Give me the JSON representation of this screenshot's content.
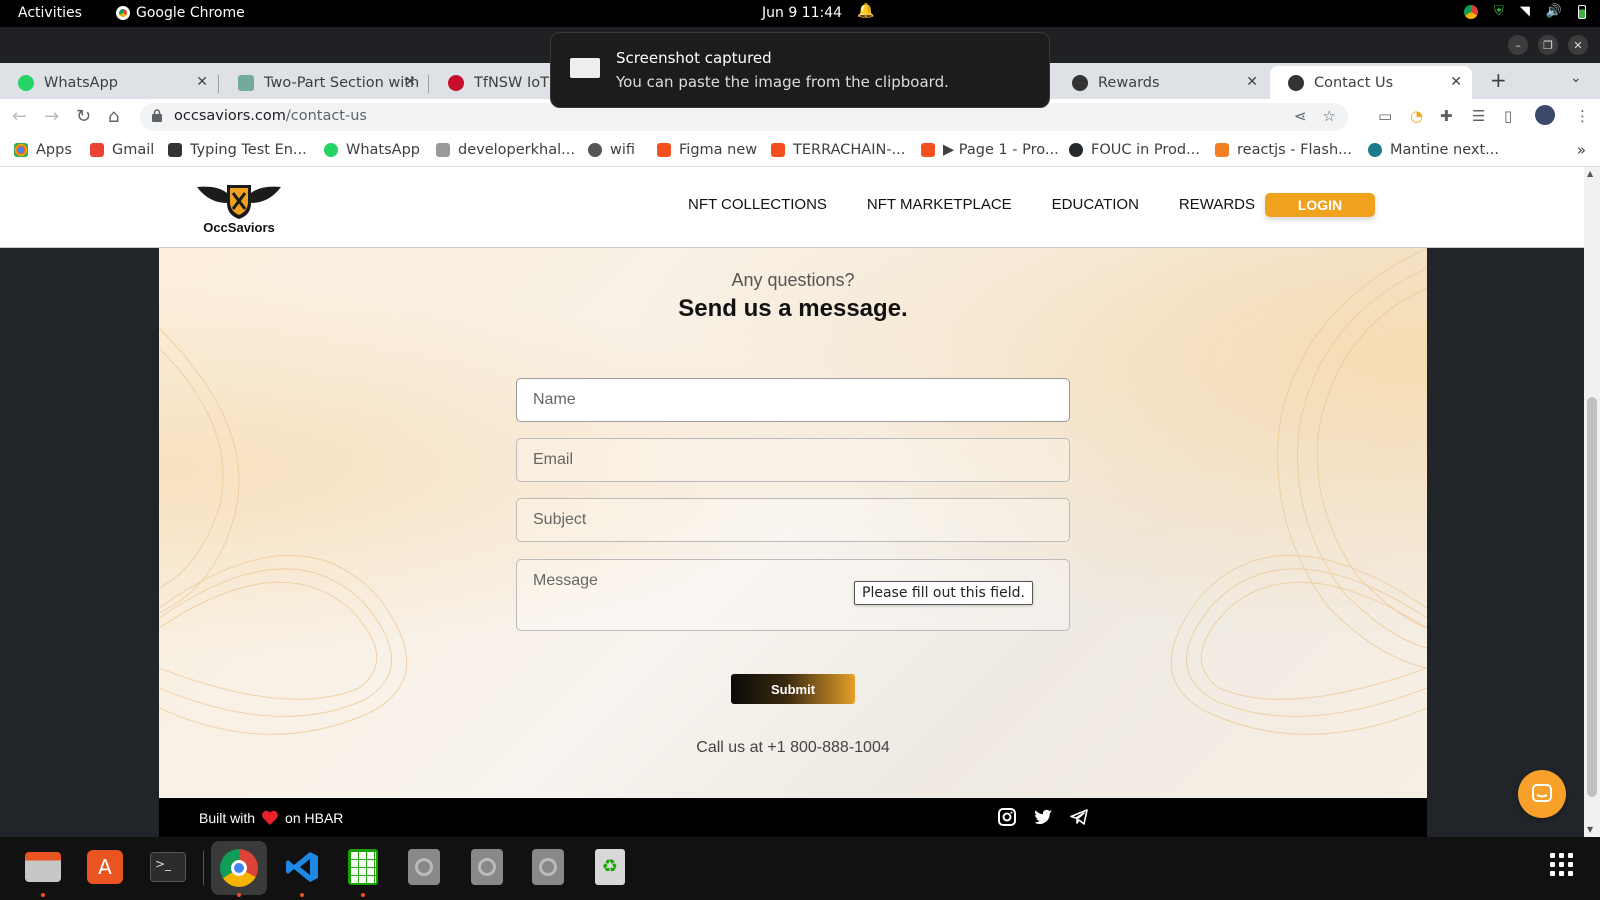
{
  "system_bar": {
    "activities": "Activities",
    "app_name": "Google Chrome",
    "clock": "Jun 9  11:44"
  },
  "tabs": [
    {
      "title": "WhatsApp",
      "active": false
    },
    {
      "title": "Two-Part Section with",
      "active": false
    },
    {
      "title": "TfNSW IoT C",
      "active": false
    },
    {
      "title": "Rewards",
      "active": false
    },
    {
      "title": "Contact Us",
      "active": true
    }
  ],
  "address_bar": {
    "domain": "occsaviors.com",
    "path": "/contact-us"
  },
  "bookmarks": [
    {
      "label": "Apps",
      "color": "#4285f4"
    },
    {
      "label": "Gmail",
      "color": "#ea4335"
    },
    {
      "label": "Typing Test En...",
      "color": "#333333"
    },
    {
      "label": "WhatsApp",
      "color": "#25d366"
    },
    {
      "label": "developerkhal...",
      "color": "#999999"
    },
    {
      "label": "wifi",
      "color": "#555555"
    },
    {
      "label": "Figma new",
      "color": "#f24e1e"
    },
    {
      "label": "TERRACHAIN-...",
      "color": "#f24e1e"
    },
    {
      "label": "▶ Page 1 - Pro...",
      "color": "#f24e1e"
    },
    {
      "label": "FOUC in Prod...",
      "color": "#24292e"
    },
    {
      "label": "reactjs - Flash...",
      "color": "#f48024"
    },
    {
      "label": "Mantine next...",
      "color": "#1c7c8c"
    }
  ],
  "notification": {
    "title": "Screenshot captured",
    "body": "You can paste the image from the clipboard."
  },
  "site": {
    "brand": "OccSaviors",
    "nav": [
      "NFT COLLECTIONS",
      "NFT MARKETPLACE",
      "EDUCATION",
      "REWARDS"
    ],
    "login": "LOGIN",
    "accent": "#f0a21f"
  },
  "contact": {
    "kicker": "Any questions?",
    "heading": "Send us a message.",
    "fields": {
      "name": "Name",
      "email": "Email",
      "subject": "Subject",
      "message": "Message"
    },
    "validation_tooltip": "Please fill out this field.",
    "submit": "Submit",
    "phone_line": "Call us at +1 800-888-1004"
  },
  "footer": {
    "built_prefix": "Built with",
    "built_suffix": "on HBAR",
    "socials": [
      "instagram-icon",
      "twitter-icon",
      "telegram-icon"
    ]
  },
  "dock": [
    "files",
    "app-center",
    "terminal",
    "chrome",
    "vscode",
    "spreadsheet",
    "disc-1",
    "disc-2",
    "disc-3",
    "trash"
  ]
}
